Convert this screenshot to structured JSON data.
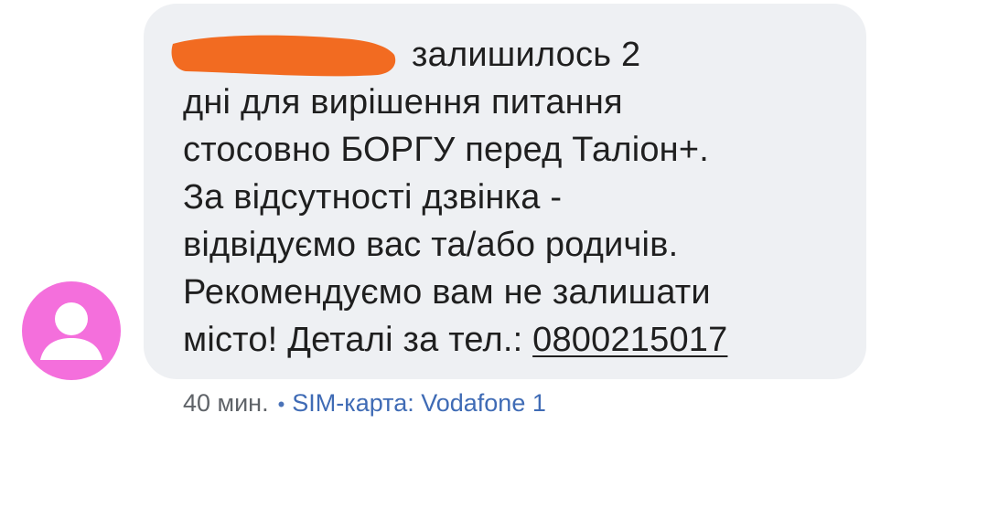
{
  "message": {
    "lines": [
      "залишилось 2",
      "дні для вирішення питання",
      "стосовно БОРГУ перед Таліон+.",
      "За відсутності дзвінка -",
      "відвідуємо вас та/або родичів.",
      "Рекомендуємо вам не залишати"
    ],
    "last_line_prefix": "місто! Деталі за тел.: ",
    "phone": "0800215017"
  },
  "meta": {
    "time": "40 мин.",
    "separator": "•",
    "sim": "SIM-карта: Vodafone 1"
  },
  "colors": {
    "bubble": "#eef0f3",
    "avatar": "#f46fdc",
    "redaction": "#f26b21",
    "meta_link": "#3f6bb5"
  },
  "icons": {
    "avatar": "person-icon"
  }
}
